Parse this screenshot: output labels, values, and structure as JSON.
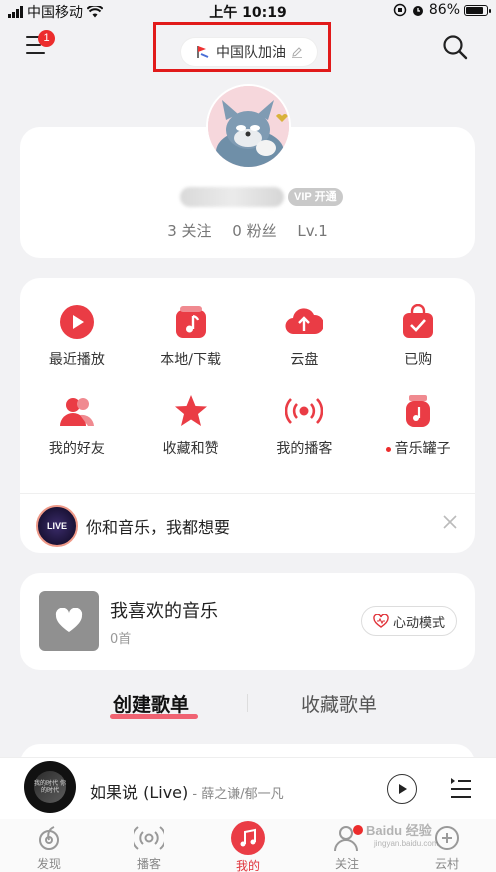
{
  "status_bar": {
    "carrier": "中国移动",
    "time": "上午 10:19",
    "battery": "86%",
    "battery_level": 0.86
  },
  "header": {
    "menu_badge": "1",
    "title": "中国队加油"
  },
  "profile": {
    "vip_label": "VIP 开通",
    "stats": [
      "3 关注",
      "0 粉丝",
      "Lv.1"
    ]
  },
  "shortcuts": [
    {
      "label": "最近播放",
      "icon": "play-icon"
    },
    {
      "label": "本地/下载",
      "icon": "music-note-icon"
    },
    {
      "label": "云盘",
      "icon": "cloud-upload-icon"
    },
    {
      "label": "已购",
      "icon": "purchased-bag-icon"
    },
    {
      "label": "我的好友",
      "icon": "friends-icon"
    },
    {
      "label": "收藏和赞",
      "icon": "star-icon"
    },
    {
      "label": "我的播客",
      "icon": "podcast-icon"
    },
    {
      "label": "音乐罐子",
      "icon": "music-jar-icon"
    }
  ],
  "promo": {
    "thumb_text": "LIVE",
    "text": "你和音乐，我都想要"
  },
  "favorites": {
    "title": "我喜欢的音乐",
    "count": "0首",
    "mode_button": "心动模式"
  },
  "playlist_tabs": {
    "active": "创建歌单",
    "inactive": "收藏歌单"
  },
  "mini_player": {
    "song": "如果说 (Live)",
    "artist": " - 薛之谦/郁一凡",
    "cover_text": "我的时代 你的时代"
  },
  "tab_bar": [
    {
      "label": "发现",
      "icon": "discover-icon"
    },
    {
      "label": "播客",
      "icon": "podcast-icon"
    },
    {
      "label": "我的",
      "icon": "music-note-icon"
    },
    {
      "label": "关注",
      "icon": "follow-user-icon"
    },
    {
      "label": "云村",
      "icon": "cloud-village-icon"
    }
  ],
  "watermark": {
    "text": "Baidu 经验",
    "sub": "jingyan.baidu.com"
  },
  "colors": {
    "accent": "#ea3c45",
    "highlight_box": "#e11a1a"
  }
}
